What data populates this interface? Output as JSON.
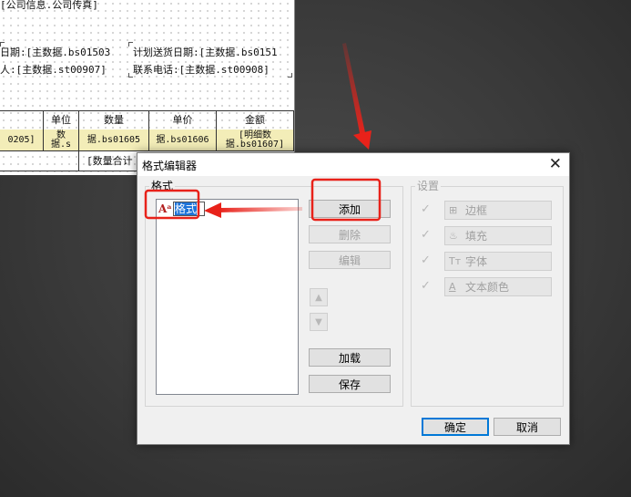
{
  "sheet": {
    "line1": "[公司信息.公司传真]",
    "line2a": "日期:[主数据.bs01503",
    "line2b": "计划送货日期:[主数据.bs0151",
    "line3a": "人:[主数据.st00907]",
    "line3b": "联系电话:[主数据.st00908]",
    "headers": [
      "",
      "单位",
      "数量",
      "单价",
      "金额"
    ],
    "row": [
      "0205]",
      "据.s",
      "据.bs01605",
      "据.bs01606",
      "据.bs01607]"
    ],
    "row_top": [
      "",
      "数",
      "",
      "",
      "[明细数"
    ],
    "sum_label": "[数量合计"
  },
  "dialog": {
    "title": "格式编辑器",
    "close": "✕",
    "format_group": "格式",
    "list_item_icon": "Aᵃ",
    "list_item_text": "格式",
    "buttons": {
      "add": "添加",
      "delete": "删除",
      "edit": "编辑",
      "up": "▲",
      "down": "▼",
      "load": "加载",
      "save": "保存",
      "ok": "确定",
      "cancel": "取消"
    },
    "settings_group": "设置",
    "settings": [
      {
        "label": "边框",
        "icon": "border-icon"
      },
      {
        "label": "填充",
        "icon": "fill-icon"
      },
      {
        "label": "字体",
        "icon": "font-icon"
      },
      {
        "label": "文本颜色",
        "icon": "text-color-icon"
      }
    ]
  },
  "annotation_color": "#e8221a"
}
